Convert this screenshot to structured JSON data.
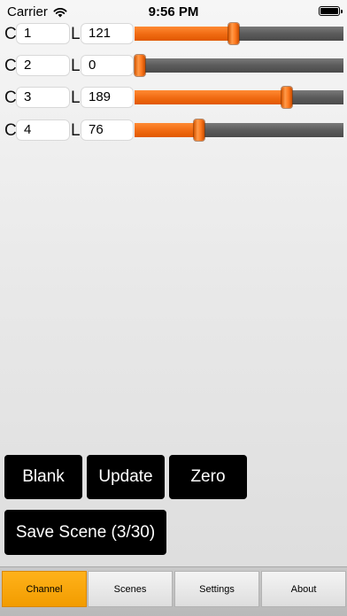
{
  "status_bar": {
    "carrier": "Carrier",
    "time": "9:56 PM",
    "icons": [
      "wifi-icon",
      "battery-icon"
    ]
  },
  "row_labels": {
    "channel_prefix": "C",
    "level_prefix": "L"
  },
  "channels": [
    {
      "channel": "1",
      "level": "121",
      "slider_fraction": 0.475
    },
    {
      "channel": "2",
      "level": "0",
      "slider_fraction": 0.0
    },
    {
      "channel": "3",
      "level": "189",
      "slider_fraction": 0.741
    },
    {
      "channel": "4",
      "level": "76",
      "slider_fraction": 0.298
    }
  ],
  "buttons": {
    "blank": "Blank",
    "update": "Update",
    "zero": "Zero",
    "save_scene": "Save Scene (3/30)"
  },
  "tabs": [
    {
      "label": "Channel",
      "active": true
    },
    {
      "label": "Scenes",
      "active": false
    },
    {
      "label": "Settings",
      "active": false
    },
    {
      "label": "About",
      "active": false
    }
  ],
  "colors": {
    "accent_orange": "#f06a12",
    "tab_active": "#f7a100",
    "button_bg": "#000000",
    "track_gray": "#5b5b5b"
  }
}
